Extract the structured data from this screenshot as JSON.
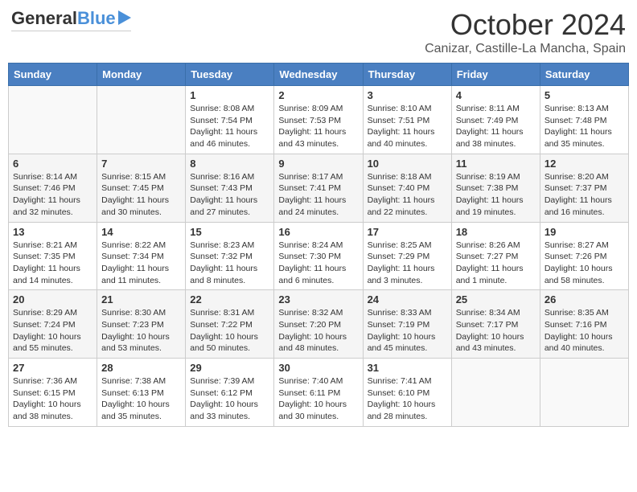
{
  "header": {
    "logo_general": "General",
    "logo_blue": "Blue",
    "month": "October 2024",
    "location": "Canizar, Castille-La Mancha, Spain"
  },
  "weekdays": [
    "Sunday",
    "Monday",
    "Tuesday",
    "Wednesday",
    "Thursday",
    "Friday",
    "Saturday"
  ],
  "weeks": [
    [
      {
        "day": "",
        "info": ""
      },
      {
        "day": "",
        "info": ""
      },
      {
        "day": "1",
        "info": "Sunrise: 8:08 AM\nSunset: 7:54 PM\nDaylight: 11 hours and 46 minutes."
      },
      {
        "day": "2",
        "info": "Sunrise: 8:09 AM\nSunset: 7:53 PM\nDaylight: 11 hours and 43 minutes."
      },
      {
        "day": "3",
        "info": "Sunrise: 8:10 AM\nSunset: 7:51 PM\nDaylight: 11 hours and 40 minutes."
      },
      {
        "day": "4",
        "info": "Sunrise: 8:11 AM\nSunset: 7:49 PM\nDaylight: 11 hours and 38 minutes."
      },
      {
        "day": "5",
        "info": "Sunrise: 8:13 AM\nSunset: 7:48 PM\nDaylight: 11 hours and 35 minutes."
      }
    ],
    [
      {
        "day": "6",
        "info": "Sunrise: 8:14 AM\nSunset: 7:46 PM\nDaylight: 11 hours and 32 minutes."
      },
      {
        "day": "7",
        "info": "Sunrise: 8:15 AM\nSunset: 7:45 PM\nDaylight: 11 hours and 30 minutes."
      },
      {
        "day": "8",
        "info": "Sunrise: 8:16 AM\nSunset: 7:43 PM\nDaylight: 11 hours and 27 minutes."
      },
      {
        "day": "9",
        "info": "Sunrise: 8:17 AM\nSunset: 7:41 PM\nDaylight: 11 hours and 24 minutes."
      },
      {
        "day": "10",
        "info": "Sunrise: 8:18 AM\nSunset: 7:40 PM\nDaylight: 11 hours and 22 minutes."
      },
      {
        "day": "11",
        "info": "Sunrise: 8:19 AM\nSunset: 7:38 PM\nDaylight: 11 hours and 19 minutes."
      },
      {
        "day": "12",
        "info": "Sunrise: 8:20 AM\nSunset: 7:37 PM\nDaylight: 11 hours and 16 minutes."
      }
    ],
    [
      {
        "day": "13",
        "info": "Sunrise: 8:21 AM\nSunset: 7:35 PM\nDaylight: 11 hours and 14 minutes."
      },
      {
        "day": "14",
        "info": "Sunrise: 8:22 AM\nSunset: 7:34 PM\nDaylight: 11 hours and 11 minutes."
      },
      {
        "day": "15",
        "info": "Sunrise: 8:23 AM\nSunset: 7:32 PM\nDaylight: 11 hours and 8 minutes."
      },
      {
        "day": "16",
        "info": "Sunrise: 8:24 AM\nSunset: 7:30 PM\nDaylight: 11 hours and 6 minutes."
      },
      {
        "day": "17",
        "info": "Sunrise: 8:25 AM\nSunset: 7:29 PM\nDaylight: 11 hours and 3 minutes."
      },
      {
        "day": "18",
        "info": "Sunrise: 8:26 AM\nSunset: 7:27 PM\nDaylight: 11 hours and 1 minute."
      },
      {
        "day": "19",
        "info": "Sunrise: 8:27 AM\nSunset: 7:26 PM\nDaylight: 10 hours and 58 minutes."
      }
    ],
    [
      {
        "day": "20",
        "info": "Sunrise: 8:29 AM\nSunset: 7:24 PM\nDaylight: 10 hours and 55 minutes."
      },
      {
        "day": "21",
        "info": "Sunrise: 8:30 AM\nSunset: 7:23 PM\nDaylight: 10 hours and 53 minutes."
      },
      {
        "day": "22",
        "info": "Sunrise: 8:31 AM\nSunset: 7:22 PM\nDaylight: 10 hours and 50 minutes."
      },
      {
        "day": "23",
        "info": "Sunrise: 8:32 AM\nSunset: 7:20 PM\nDaylight: 10 hours and 48 minutes."
      },
      {
        "day": "24",
        "info": "Sunrise: 8:33 AM\nSunset: 7:19 PM\nDaylight: 10 hours and 45 minutes."
      },
      {
        "day": "25",
        "info": "Sunrise: 8:34 AM\nSunset: 7:17 PM\nDaylight: 10 hours and 43 minutes."
      },
      {
        "day": "26",
        "info": "Sunrise: 8:35 AM\nSunset: 7:16 PM\nDaylight: 10 hours and 40 minutes."
      }
    ],
    [
      {
        "day": "27",
        "info": "Sunrise: 7:36 AM\nSunset: 6:15 PM\nDaylight: 10 hours and 38 minutes."
      },
      {
        "day": "28",
        "info": "Sunrise: 7:38 AM\nSunset: 6:13 PM\nDaylight: 10 hours and 35 minutes."
      },
      {
        "day": "29",
        "info": "Sunrise: 7:39 AM\nSunset: 6:12 PM\nDaylight: 10 hours and 33 minutes."
      },
      {
        "day": "30",
        "info": "Sunrise: 7:40 AM\nSunset: 6:11 PM\nDaylight: 10 hours and 30 minutes."
      },
      {
        "day": "31",
        "info": "Sunrise: 7:41 AM\nSunset: 6:10 PM\nDaylight: 10 hours and 28 minutes."
      },
      {
        "day": "",
        "info": ""
      },
      {
        "day": "",
        "info": ""
      }
    ]
  ]
}
